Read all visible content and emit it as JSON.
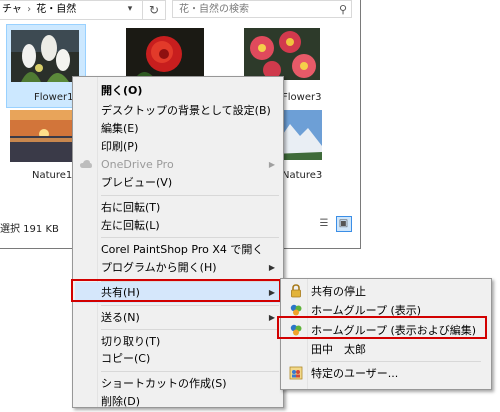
{
  "address": {
    "crumb1": "チャ",
    "sep": "›",
    "crumb2": "花・自然",
    "dropdown_icon": "chevron-down-icon",
    "refresh_icon": "refresh-icon",
    "search_placeholder": "花・自然の検索",
    "search_icon": "search-icon"
  },
  "files": [
    {
      "name": "Flower1"
    },
    {
      "name": "Flower3"
    },
    {
      "name": "Nature1"
    },
    {
      "name": "Nature3"
    }
  ],
  "status": {
    "text": "選択  191 KB",
    "views": [
      "details-view-icon",
      "large-icons-view-icon"
    ]
  },
  "menu": {
    "items": [
      {
        "label": "開く(O)",
        "bold": true
      },
      {
        "label": "デスクトップの背景として設定(B)"
      },
      {
        "label": "編集(E)"
      },
      {
        "label": "印刷(P)"
      },
      {
        "label": "OneDrive Pro",
        "disabled": true,
        "submenu": true
      },
      {
        "label": "プレビュー(V)"
      },
      {
        "label": "右に回転(T)"
      },
      {
        "label": "左に回転(L)"
      },
      {
        "label": "Corel PaintShop Pro X4 で開く"
      },
      {
        "label": "プログラムから開く(H)",
        "submenu": true
      },
      {
        "label": "共有(H)",
        "submenu": true,
        "highlighted": true
      },
      {
        "label": "送る(N)",
        "submenu": true
      },
      {
        "label": "切り取り(T)"
      },
      {
        "label": "コピー(C)"
      },
      {
        "label": "ショートカットの作成(S)"
      },
      {
        "label": "削除(D)"
      }
    ]
  },
  "submenu": {
    "items": [
      {
        "label": "共有の停止",
        "icon": "lock-icon"
      },
      {
        "label": "ホームグループ (表示)",
        "icon": "homegroup-icon"
      },
      {
        "label": "ホームグループ (表示および編集)",
        "icon": "homegroup-icon"
      },
      {
        "label": "田中　太郎",
        "icon": ""
      },
      {
        "label": "特定のユーザー...",
        "icon": "users-icon"
      }
    ]
  },
  "colors": {
    "highlight_box": "#d20000",
    "selection": "#cce8ff",
    "menu_bg": "#f0f0f0"
  }
}
